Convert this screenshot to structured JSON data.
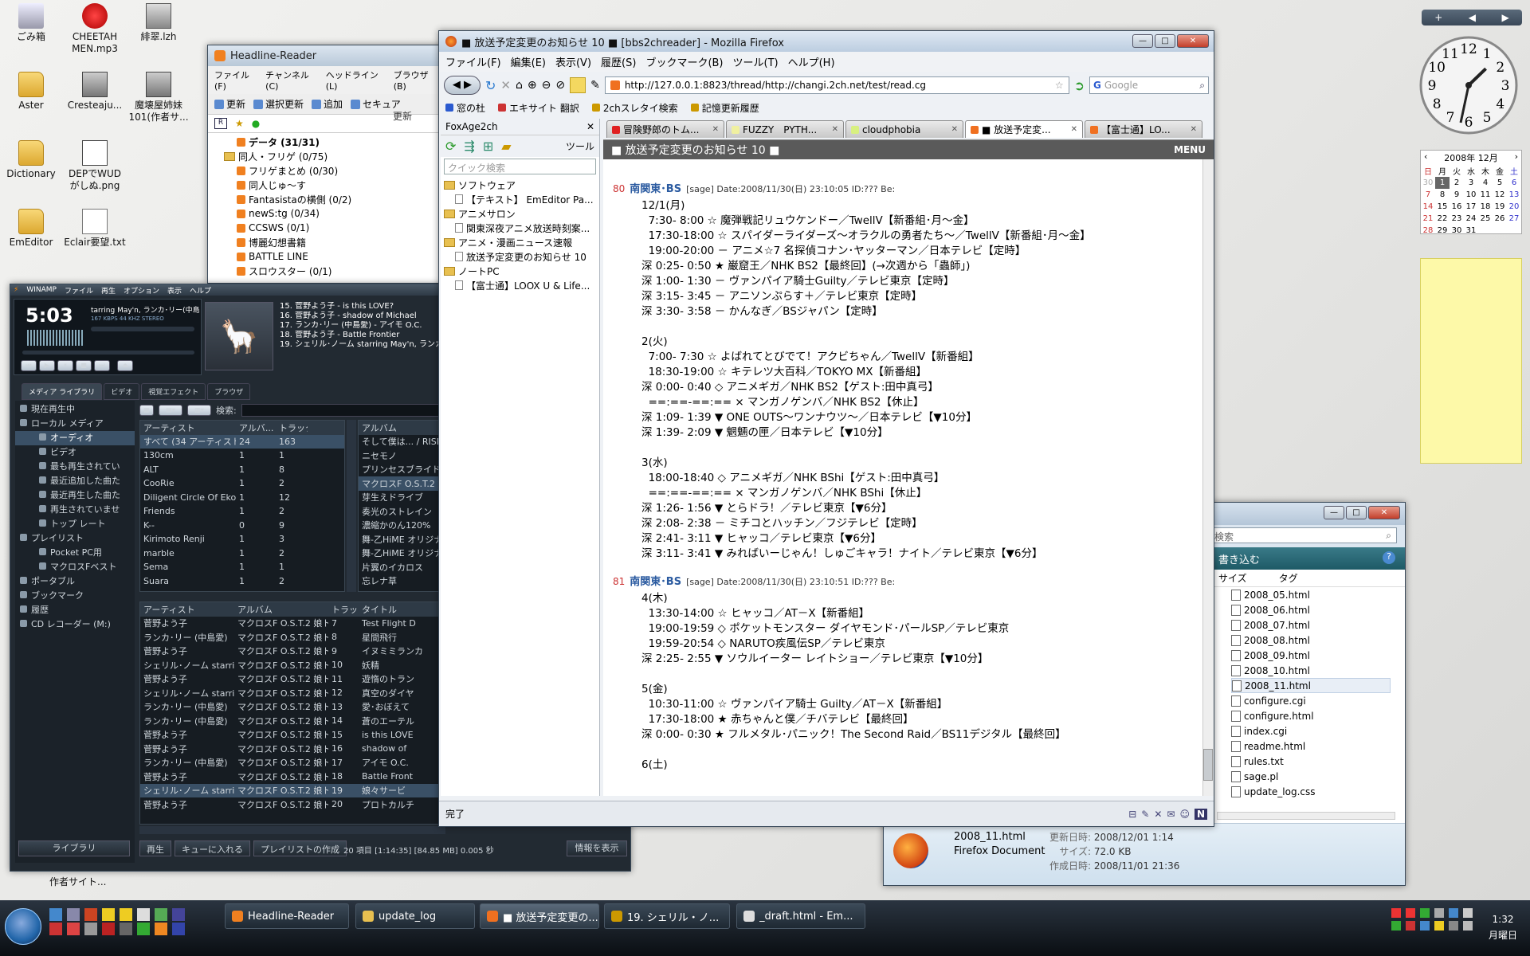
{
  "desktop": {
    "icons": [
      {
        "label": "ごみ箱",
        "icon": "recycle-bin-icon"
      },
      {
        "label": "CHEETAH\nMEN.mp3",
        "icon": "mp3-file-icon"
      },
      {
        "label": "緋翠.lzh",
        "icon": "archive-icon"
      },
      {
        "label": "Aster",
        "icon": "folder-icon"
      },
      {
        "label": "Cresteaju...",
        "icon": "app-icon"
      },
      {
        "label": "魔壊屋姉妹\n101(作者サ...",
        "icon": "app-icon"
      },
      {
        "label": "Dictionary",
        "icon": "folder-icon"
      },
      {
        "label": "DEPでWUD\nがしぬ.png",
        "icon": "image-file-icon"
      },
      {
        "label": "EmEditor",
        "icon": "folder-icon"
      },
      {
        "label": "Eclair要望.txt",
        "icon": "text-file-icon"
      }
    ],
    "partial_label": "作者サイト..."
  },
  "headline_reader": {
    "title": "Headline-Reader",
    "menu": [
      "ファイル(F)",
      "チャンネル(C)",
      "ヘッドライン(L)",
      "ブラウザ(B)"
    ],
    "toolbar": [
      "更新",
      "選択更新",
      "追加",
      "セキュア"
    ],
    "right_label": "更新",
    "tree": [
      {
        "label": "データ (31/31)",
        "bold": true,
        "indent": 2
      },
      {
        "label": "同人・フリゲ (0/75)",
        "bold": false,
        "indent": 1
      },
      {
        "label": "フリゲまとめ (0/30)",
        "bold": false,
        "indent": 2
      },
      {
        "label": "同人じゅ～す",
        "bold": false,
        "indent": 2
      },
      {
        "label": "Fantasistaの横側 (0/2)",
        "bold": false,
        "indent": 2
      },
      {
        "label": "newS:tg (0/34)",
        "bold": false,
        "indent": 2
      },
      {
        "label": "CCSWS (0/1)",
        "bold": false,
        "indent": 2
      },
      {
        "label": "博麗幻想書籍",
        "bold": false,
        "indent": 2
      },
      {
        "label": "BATTLE LINE",
        "bold": false,
        "indent": 2
      },
      {
        "label": "スロウスター (0/1)",
        "bold": false,
        "indent": 2
      }
    ]
  },
  "winamp": {
    "brand": "WINAMP",
    "menu": [
      "ファイル",
      "再生",
      "オプション",
      "表示",
      "ヘルプ"
    ],
    "time": "5:03",
    "song_scroll": "tarring May'n, ランカ･リー(中島愛),",
    "bitrate": "167 KBPS  44 KHZ  STEREO",
    "playlist": [
      "15. 菅野よう子 - is this LOVE?",
      "16. 菅野よう子 - shadow of Michael",
      "17. ランカ･リー (中島愛) - アイモ O.C.",
      "18. 菅野よう子 - Battle Frontier",
      "19. シェリル･ノーム starring May'n, ランカ"
    ],
    "tabs": [
      "メディア ライブラリ",
      "ビデオ",
      "視覚エフェクト",
      "ブラウザ"
    ],
    "nav": [
      {
        "label": "現在再生中",
        "indent": 0
      },
      {
        "label": "ローカル メディア",
        "indent": 0
      },
      {
        "label": "オーディオ",
        "indent": 2,
        "selected": true
      },
      {
        "label": "ビデオ",
        "indent": 2
      },
      {
        "label": "最も再生されてい",
        "indent": 2
      },
      {
        "label": "最近追加した曲た",
        "indent": 2
      },
      {
        "label": "最近再生した曲た",
        "indent": 2
      },
      {
        "label": "再生されていませ",
        "indent": 2
      },
      {
        "label": "トップ レート",
        "indent": 2
      },
      {
        "label": "プレイリスト",
        "indent": 0
      },
      {
        "label": "Pocket PC用",
        "indent": 2
      },
      {
        "label": "マクロスFベスト",
        "indent": 2
      },
      {
        "label": "ポータブル",
        "indent": 0
      },
      {
        "label": "ブックマーク",
        "indent": 0
      },
      {
        "label": "履歴",
        "indent": 0
      },
      {
        "label": "CD レコーダー (M:)",
        "indent": 0
      }
    ],
    "search_label": "検索:",
    "artist_headers": [
      "アーティスト",
      "アルバ...",
      "トラック"
    ],
    "artists": [
      [
        "すべて (34 アーティスト)",
        "24",
        "163"
      ],
      [
        "130cm",
        "1",
        "1"
      ],
      [
        "ALT",
        "1",
        "8"
      ],
      [
        "CooRie",
        "1",
        "2"
      ],
      [
        "Diligent Circle Of Ekoda",
        "1",
        "12"
      ],
      [
        "Friends",
        "1",
        "2"
      ],
      [
        "K--",
        "0",
        "9"
      ],
      [
        "Kirimoto Renji",
        "1",
        "3"
      ],
      [
        "marble",
        "1",
        "2"
      ],
      [
        "Sema",
        "1",
        "1"
      ],
      [
        "Suara",
        "1",
        "2"
      ]
    ],
    "album_header": "アルバム",
    "albums": [
      "そして僕は... / RISE",
      "ニセモノ",
      "プリンセスブライド",
      "マクロスF O.S.T.2 娘",
      "芽生えドライブ",
      "奏光のストレイン",
      "濃縮かのん120%",
      "舞-乙HiME オリジナル",
      "舞-乙HiME オリジナル",
      "片翼のイカロス",
      "忘レナ草"
    ],
    "track_headers": [
      "アーティスト",
      "アルバム",
      "トラッ...",
      "タイトル"
    ],
    "tracks": [
      [
        "菅野よう子",
        "マクロスF O.S.T.2 娘ト...",
        "7",
        "Test Flight D"
      ],
      [
        "ランカ･リー (中島愛)",
        "マクロスF O.S.T.2 娘ト...",
        "8",
        "星間飛行"
      ],
      [
        "菅野よう子",
        "マクロスF O.S.T.2 娘ト...",
        "9",
        "イヌミミランカ"
      ],
      [
        "シェリル･ノーム starring M...",
        "マクロスF O.S.T.2 娘ト...",
        "10",
        "妖精"
      ],
      [
        "菅野よう子",
        "マクロスF O.S.T.2 娘ト...",
        "11",
        "遊惰のトラン"
      ],
      [
        "シェリル･ノーム starring M...",
        "マクロスF O.S.T.2 娘ト...",
        "12",
        "真空のダイヤ"
      ],
      [
        "ランカ･リー (中島愛)",
        "マクロスF O.S.T.2 娘ト...",
        "13",
        "愛･おぼえて"
      ],
      [
        "ランカ･リー (中島愛)",
        "マクロスF O.S.T.2 娘ト...",
        "14",
        "蒼のエーテル"
      ],
      [
        "菅野よう子",
        "マクロスF O.S.T.2 娘ト...",
        "15",
        "is this LOVE"
      ],
      [
        "菅野よう子",
        "マクロスF O.S.T.2 娘ト...",
        "16",
        "shadow of"
      ],
      [
        "ランカ･リー (中島愛)",
        "マクロスF O.S.T.2 娘ト...",
        "17",
        "アイモ O.C."
      ],
      [
        "菅野よう子",
        "マクロスF O.S.T.2 娘ト...",
        "18",
        "Battle Front"
      ],
      [
        "シェリル･ノーム starring M...",
        "マクロスF O.S.T.2 娘ト...",
        "19",
        "娘々サービ"
      ],
      [
        "菅野よう子",
        "マクロスF O.S.T.2 娘ト...",
        "20",
        "プロトカルチ"
      ]
    ],
    "library_button": "ライブラリ",
    "bottom_buttons": [
      "再生",
      "キューに入れる",
      "プレイリストの作成"
    ],
    "status": "20 項目 [1:14:35] [84.85 MB]  0.005 秒",
    "info_button": "情報を表示"
  },
  "firefox": {
    "title": "■ 放送予定変更のお知らせ 10 ■ [bbs2chreader] - Mozilla Firefox",
    "menu": [
      "ファイル(F)",
      "編集(E)",
      "表示(V)",
      "履歴(S)",
      "ブックマーク(B)",
      "ツール(T)",
      "ヘルプ(H)"
    ],
    "url": "http://127.0.0.1:8823/thread/http://changi.2ch.net/test/read.cg",
    "search_placeholder": "Google",
    "bookmarks": [
      "窓の杜",
      "エキサイト 翻訳",
      "2chスレタイ検索",
      "記憶更新履歴"
    ],
    "sidebar_title": "FoxAge2ch",
    "sidebar_tools": "ツール",
    "sidebar_search": "クイック検索",
    "sidebar_items": [
      {
        "label": "ソフトウェア",
        "type": "folder",
        "indent": 0
      },
      {
        "label": "【テキスト】 EmEditor Pa...",
        "type": "thread",
        "indent": 1
      },
      {
        "label": "アニメサロン",
        "type": "folder",
        "indent": 0
      },
      {
        "label": "関東深夜アニメ放送時刻案...",
        "type": "thread",
        "indent": 1
      },
      {
        "label": "アニメ・漫画ニュース速報",
        "type": "folder",
        "indent": 0
      },
      {
        "label": "放送予定変更のお知らせ 10",
        "type": "thread",
        "indent": 1
      },
      {
        "label": "ノートPC",
        "type": "folder",
        "indent": 0
      },
      {
        "label": "【富士通】LOOX U & Life...",
        "type": "thread",
        "indent": 1
      }
    ],
    "tabs": [
      {
        "label": "冒険野郎のトム...",
        "color": "#e02020",
        "active": false
      },
      {
        "label": "FUZZY　PYTH...",
        "color": "#f0f0a0",
        "active": false
      },
      {
        "label": "cloudphobia",
        "color": "#d8f080",
        "active": false
      },
      {
        "label": "■ 放送予定変...",
        "color": "#f07020",
        "active": true
      },
      {
        "label": "【富士通】LO...",
        "color": "#f07020",
        "active": false
      }
    ],
    "thread_title": "■ 放送予定変更のお知らせ 10 ■",
    "thread_menu": "MENU",
    "posts": [
      {
        "num": "80",
        "name": "南関東･BS",
        "meta": "[sage] Date:2008/11/30(日) 23:10:05  ID:??? Be:",
        "lines": [
          "12/1(月)",
          "  7:30- 8:00 ☆ 魔弾戦記リュウケンドー／TwellV【新番組･月～金】",
          "  17:30-18:00 ☆ スパイダーライダーズ～オラクルの勇者たち～／TwellV【新番組･月～金】",
          "  19:00-20:00 － アニメ☆7 名探偵コナン･ヤッターマン／日本テレビ【定時】",
          "深 0:25- 0:50 ★ 巌窟王／NHK BS2【最終回】(→次週から「蟲師」)",
          "深 1:00- 1:30 － ヴァンパイア騎士Guilty／テレビ東京【定時】",
          "深 3:15- 3:45 － アニソンぷらす＋／テレビ東京【定時】",
          "深 3:30- 3:58 － かんなぎ／BSジャパン【定時】",
          "",
          "2(火)",
          "  7:00- 7:30 ☆ よばれてとびでて！アクビちゃん／TwellV【新番組】",
          "  18:30-19:00 ☆ キテレツ大百科／TOKYO MX【新番組】",
          "深 0:00- 0:40 ◇ アニメギガ／NHK BS2【ゲスト:田中真弓】",
          "  ==:==-==:== × マンガノゲンバ／NHK BS2【休止】",
          "深 1:09- 1:39 ▼ ONE OUTS～ワンナウツ～／日本テレビ【▼10分】",
          "深 1:39- 2:09 ▼ 魍魎の匣／日本テレビ【▼10分】",
          "",
          "3(水)",
          "  18:00-18:40 ◇ アニメギガ／NHK BShi【ゲスト:田中真弓】",
          "  ==:==-==:== × マンガノゲンバ／NHK BShi【休止】",
          "深 1:26- 1:56 ▼ とらドラ！／テレビ東京【▼6分】",
          "深 2:08- 2:38 － ミチコとハッチン／フジテレビ【定時】",
          "深 2:41- 3:11 ▼ ヒャッコ／テレビ東京【▼6分】",
          "深 3:11- 3:41 ▼ みればいーじゃん！しゅごキャラ！ナイト／テレビ東京【▼6分】"
        ]
      },
      {
        "num": "81",
        "name": "南関東･BS",
        "meta": "[sage] Date:2008/11/30(日) 23:10:51  ID:??? Be:",
        "lines": [
          "4(木)",
          "  13:30-14:00 ☆ ヒャッコ／AT－X【新番組】",
          "  19:00-19:59 ◇ ポケットモンスター ダイヤモンド･パールSP／テレビ東京",
          "  19:59-20:54 ◇ NARUTO疾風伝SP／テレビ東京",
          "深 2:25- 2:55 ▼ ソウルイーター レイトショー／テレビ東京【▼10分】",
          "",
          "5(金)",
          "  10:30-11:00 ☆ ヴァンパイア騎士 Guilty／AT－X【新番組】",
          "  17:30-18:00 ★ 赤ちゃんと僕／チバテレビ【最終回】",
          "深 0:00- 0:30 ★ フルメタル･パニック！The Second Raid／BS11デジタル【最終回】",
          "",
          "6(土)"
        ]
      }
    ],
    "status": "完了",
    "status_right": "N"
  },
  "explorer": {
    "search_placeholder": "検索",
    "toolbar_label": "書き込む",
    "col_size": "サイズ",
    "col_tag": "タグ",
    "files": [
      "2008_05.html",
      "2008_06.html",
      "2008_07.html",
      "2008_08.html",
      "2008_09.html",
      "2008_10.html",
      "2008_11.html",
      "configure.cgi",
      "configure.html",
      "index.cgi",
      "readme.html",
      "rules.txt",
      "sage.pl",
      "update_log.css"
    ],
    "details": {
      "name": "2008_11.html",
      "type": "Firefox Document",
      "modified_label": "更新日時:",
      "modified": "2008/12/01 1:14",
      "size_label": "サイズ:",
      "size": "72.0 KB",
      "created_label": "作成日時:",
      "created": "2008/11/01 21:36"
    }
  },
  "calendar": {
    "title": "2008年 12月",
    "weekdays": [
      "日",
      "月",
      "火",
      "水",
      "木",
      "金",
      "土"
    ],
    "weeks": [
      [
        "30",
        "1",
        "2",
        "3",
        "4",
        "5",
        "6"
      ],
      [
        "7",
        "8",
        "9",
        "10",
        "11",
        "12",
        "13"
      ],
      [
        "14",
        "15",
        "16",
        "17",
        "18",
        "19",
        "20"
      ],
      [
        "21",
        "22",
        "23",
        "24",
        "25",
        "26",
        "27"
      ],
      [
        "28",
        "29",
        "30",
        "31",
        "",
        "",
        ""
      ]
    ],
    "today": "1"
  },
  "clock": {
    "numerals": [
      "12",
      "1",
      "2",
      "3",
      "4",
      "5",
      "6",
      "7",
      "8",
      "9",
      "10",
      "11"
    ],
    "hour": 1,
    "minute": 32
  },
  "taskbar": {
    "buttons": [
      "Headline-Reader",
      "update_log",
      "■ 放送予定変更の...",
      "19. シェリル・ノ...",
      "_draft.html - Em..."
    ],
    "time": "1:32",
    "day": "月曜日"
  }
}
